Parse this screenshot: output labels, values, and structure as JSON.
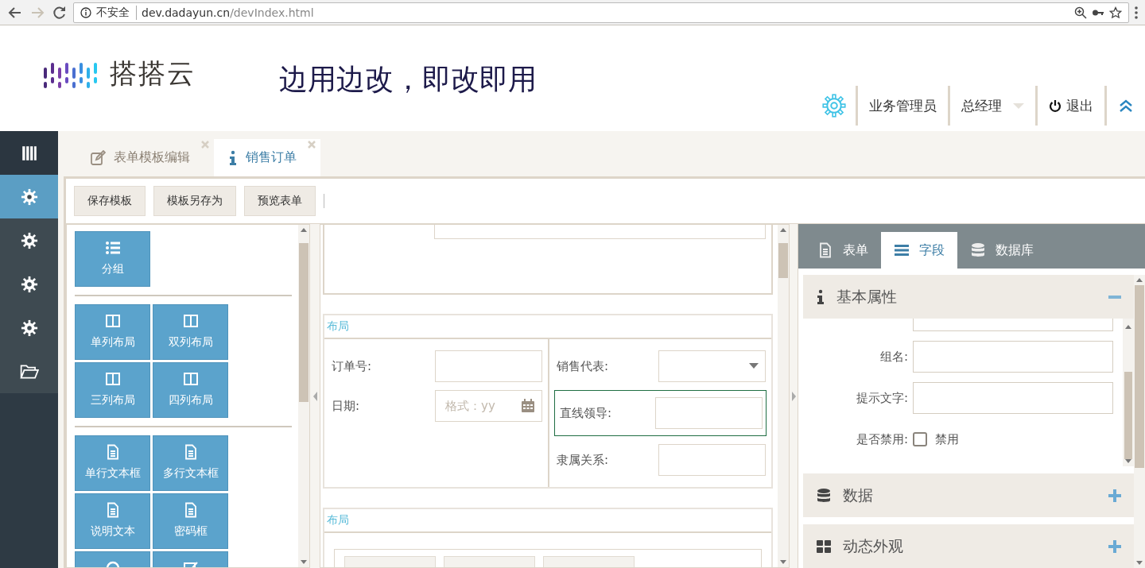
{
  "browser": {
    "security_label": "不安全",
    "url_host": "dev.dadayun.cn",
    "url_path": "/devIndex.html"
  },
  "header": {
    "logo_text": "搭搭云",
    "slogan": "边用边改，即改即用",
    "role": "业务管理员",
    "position": "总经理",
    "logout": "退出"
  },
  "sidebar": {
    "items": [
      {
        "kind": "columns",
        "selected": false
      },
      {
        "kind": "gear",
        "selected": true
      },
      {
        "kind": "gear",
        "selected": false
      },
      {
        "kind": "gear",
        "selected": false
      },
      {
        "kind": "gear",
        "selected": false
      },
      {
        "kind": "folder",
        "selected": false
      }
    ]
  },
  "tabs": [
    {
      "label": "表单模板编辑",
      "kind": "edit",
      "selected": false
    },
    {
      "label": "销售订单",
      "kind": "info",
      "selected": true
    }
  ],
  "toolbar": [
    "保存模板",
    "模板另存为",
    "预览表单"
  ],
  "palette": {
    "groups": [
      {
        "tiles": [
          {
            "label": "分组",
            "kind": "list"
          }
        ]
      },
      {
        "tiles": [
          {
            "label": "单列布局",
            "kind": "columns"
          },
          {
            "label": "双列布局",
            "kind": "columns"
          },
          {
            "label": "三列布局",
            "kind": "columns"
          },
          {
            "label": "四列布局",
            "kind": "columns"
          }
        ]
      },
      {
        "tiles": [
          {
            "label": "单行文本框",
            "kind": "file"
          },
          {
            "label": "多行文本框",
            "kind": "file"
          },
          {
            "label": "说明文本",
            "kind": "file"
          },
          {
            "label": "密码框",
            "kind": "file"
          },
          {
            "kind": "circle"
          },
          {
            "kind": "check"
          }
        ]
      }
    ]
  },
  "canvas": {
    "layouts": [
      {
        "title": "布局",
        "kind": "two_column",
        "columns": [
          [
            {
              "label": "订单号:",
              "kind": "text",
              "selected": false
            },
            {
              "label": "日期:",
              "kind": "date",
              "placeholder": "格式：yy",
              "selected": false
            }
          ],
          [
            {
              "label": "销售代表:",
              "kind": "select",
              "selected": false
            },
            {
              "label": "直线领导:",
              "kind": "text",
              "selected": true
            },
            {
              "label": "隶属关系:",
              "kind": "text",
              "selected": false
            }
          ]
        ]
      },
      {
        "title": "布局",
        "kind": "buttons"
      }
    ]
  },
  "properties": {
    "tabs": [
      {
        "label": "表单",
        "kind": "file",
        "selected": false
      },
      {
        "label": "字段",
        "kind": "lines",
        "selected": true
      },
      {
        "label": "数据库",
        "kind": "db",
        "selected": false
      }
    ],
    "sections": [
      {
        "title": "基本属性",
        "kind": "info",
        "expanded": true,
        "fields": [
          {
            "label": "组名:",
            "kind": "text"
          },
          {
            "label": "提示文字:",
            "kind": "text"
          },
          {
            "label": "是否禁用:",
            "kind": "checkbox",
            "option": "禁用",
            "checked": false
          }
        ]
      },
      {
        "title": "数据",
        "kind": "db",
        "expanded": false
      },
      {
        "title": "动态外观",
        "kind": "grid",
        "expanded": false
      }
    ]
  }
}
